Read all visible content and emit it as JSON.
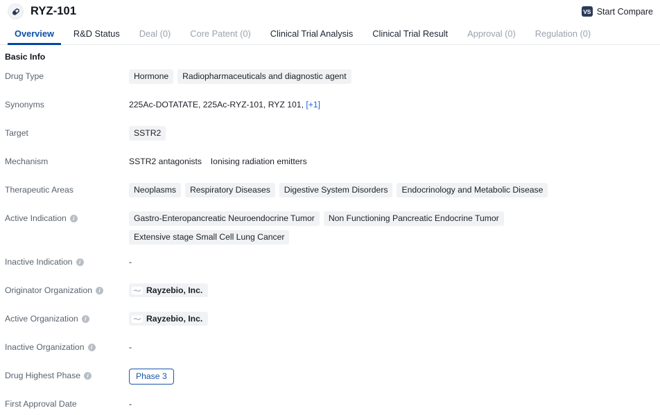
{
  "header": {
    "drug_icon": "pill-capsule-icon",
    "title": "RYZ-101",
    "compare": {
      "badge": "VS",
      "label": "Start Compare"
    }
  },
  "tabs": [
    {
      "label": "Overview",
      "state": "active"
    },
    {
      "label": "R&D Status",
      "state": "normal"
    },
    {
      "label": "Deal (0)",
      "state": "muted"
    },
    {
      "label": "Core Patent (0)",
      "state": "muted"
    },
    {
      "label": "Clinical Trial Analysis",
      "state": "normal"
    },
    {
      "label": "Clinical Trial Result",
      "state": "normal"
    },
    {
      "label": "Approval (0)",
      "state": "muted"
    },
    {
      "label": "Regulation (0)",
      "state": "muted"
    }
  ],
  "basic_info": {
    "section_title": "Basic Info",
    "rows": {
      "drug_type": {
        "label": "Drug Type",
        "chips": [
          "Hormone",
          "Radiopharmaceuticals and diagnostic agent"
        ]
      },
      "synonyms": {
        "label": "Synonyms",
        "text": "225Ac-DOTATATE, 225Ac-RYZ-101, RYZ 101,",
        "more_link": "[+1]"
      },
      "target": {
        "label": "Target",
        "chips": [
          "SSTR2"
        ]
      },
      "mechanism": {
        "label": "Mechanism",
        "part1": "SSTR2 antagonists",
        "part2": "Ionising radiation emitters"
      },
      "therapeutic_areas": {
        "label": "Therapeutic Areas",
        "chips": [
          "Neoplasms",
          "Respiratory Diseases",
          "Digestive System Disorders",
          "Endocrinology and Metabolic Disease"
        ]
      },
      "active_indication": {
        "label": "Active Indication",
        "has_info": true,
        "chips": [
          "Gastro-Enteropancreatic Neuroendocrine Tumor",
          "Non Functioning Pancreatic Endocrine Tumor",
          "Extensive stage Small Cell Lung Cancer"
        ]
      },
      "inactive_indication": {
        "label": "Inactive Indication",
        "has_info": true,
        "value": "-"
      },
      "originator_organization": {
        "label": "Originator Organization",
        "has_info": true,
        "org": "Rayzebio, Inc."
      },
      "active_organization": {
        "label": "Active Organization",
        "has_info": true,
        "org": "Rayzebio, Inc."
      },
      "inactive_organization": {
        "label": "Inactive Organization",
        "has_info": true,
        "value": "-"
      },
      "drug_highest_phase": {
        "label": "Drug Highest Phase",
        "has_info": true,
        "badge": "Phase 3"
      },
      "first_approval_date": {
        "label": "First Approval Date",
        "has_info": false,
        "value": "-"
      }
    }
  },
  "colors": {
    "accent_blue": "#0047ab",
    "link_blue": "#1565d8",
    "phase_blue": "#1a56a8",
    "chip_bg": "#f1f2f4",
    "label_gray": "#59626f",
    "muted_tab": "#9aa2ad"
  }
}
